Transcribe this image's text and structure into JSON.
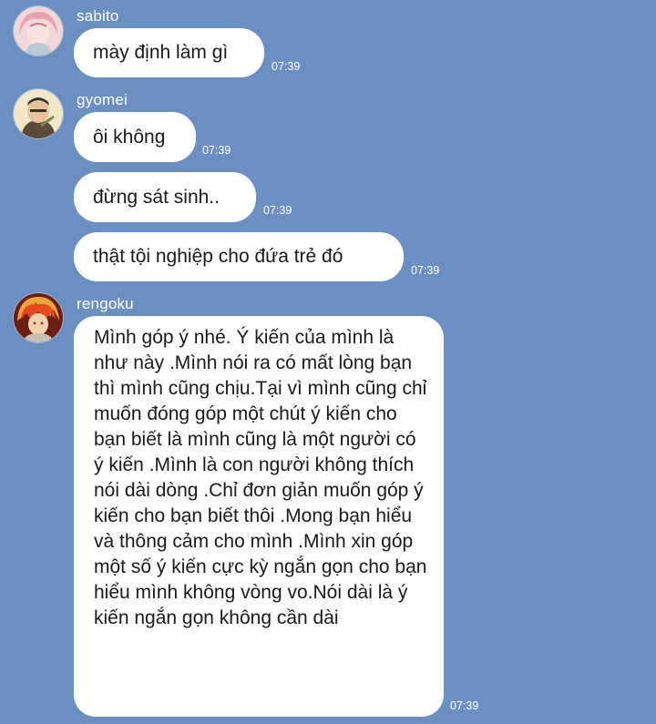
{
  "messages": [
    {
      "sender": "sabito",
      "text": "mày định làm gì",
      "time": "07:39"
    },
    {
      "sender": "gyomei",
      "text": "ôi không",
      "time": "07:39"
    },
    {
      "sender": "",
      "text": "đừng sát sinh..",
      "time": "07:39"
    },
    {
      "sender": "",
      "text": "thật tội nghiệp cho đứa trẻ đó",
      "time": "07:39"
    },
    {
      "sender": "rengoku",
      "text": "Mình góp ý nhé. Ý kiến của mình là như này .Mình nói ra có mất lòng bạn thì mình cũng chịu.Tại vì mình cũng chỉ muốn đóng góp một chút ý kiến cho bạn biết là mình cũng là một người có ý kiến .Mình là con người không thích nói dài dòng .Chỉ đơn giản muốn góp ý kiến cho bạn biết thôi .Mong bạn hiểu và thông cảm cho mình .Mình xin góp một số ý kiến cực kỳ ngắn gọn cho bạn hiểu mình không vòng vo.Nói dài là ý kiến ngắn gọn không cần dài",
      "time": "07:39"
    }
  ],
  "colors": {
    "background": "#6b8fc1",
    "bubble": "#ffffff",
    "text": "#1a1a1a",
    "meta": "#ffffff"
  },
  "icons": {
    "sabito": "avatar-sabito-icon",
    "gyomei": "avatar-gyomei-icon",
    "rengoku": "avatar-rengoku-icon"
  }
}
